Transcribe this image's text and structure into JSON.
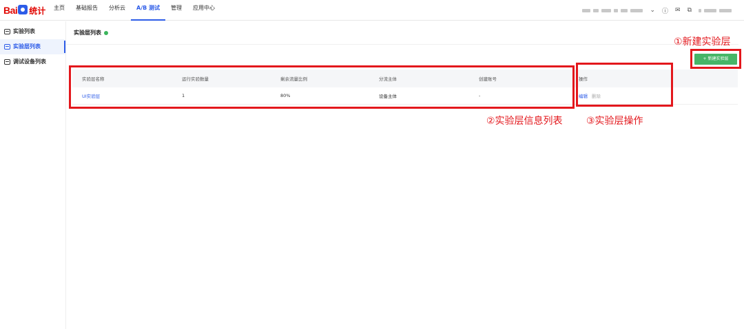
{
  "logo": {
    "bai": "Bai",
    "tongji": "统计"
  },
  "nav": [
    "主页",
    "基础报告",
    "分析云",
    "A/B 测试",
    "管理",
    "应用中心"
  ],
  "nav_active": 3,
  "header_icons": [
    "chevron-down-icon",
    "help-icon",
    "mail-icon",
    "copy-icon"
  ],
  "sidebar": {
    "items": [
      {
        "label": "实验列表",
        "icon": "list-icon"
      },
      {
        "label": "实验层列表",
        "icon": "layer-icon"
      },
      {
        "label": "调试设备列表",
        "icon": "device-icon"
      }
    ],
    "active": 1
  },
  "page": {
    "title": "实验层列表"
  },
  "new_button": "+ 新建实验层",
  "table": {
    "headers": [
      "实验层名称",
      "运行实验数量",
      "剩余流量比例",
      "分流主体",
      "创建账号",
      "操作"
    ],
    "rows": [
      {
        "name": "UI实验层",
        "count": "1",
        "ratio": "80%",
        "subject": "设备主体",
        "creator": "-",
        "edit": "编辑",
        "delete": "删除"
      }
    ]
  },
  "annotations": {
    "a1": "①新建实验层",
    "a2": "②实验层信息列表",
    "a3": "③实验层操作"
  },
  "colors": {
    "accent": "#2d5ce8",
    "button": "#46b567",
    "annotation": "#e3171c"
  }
}
